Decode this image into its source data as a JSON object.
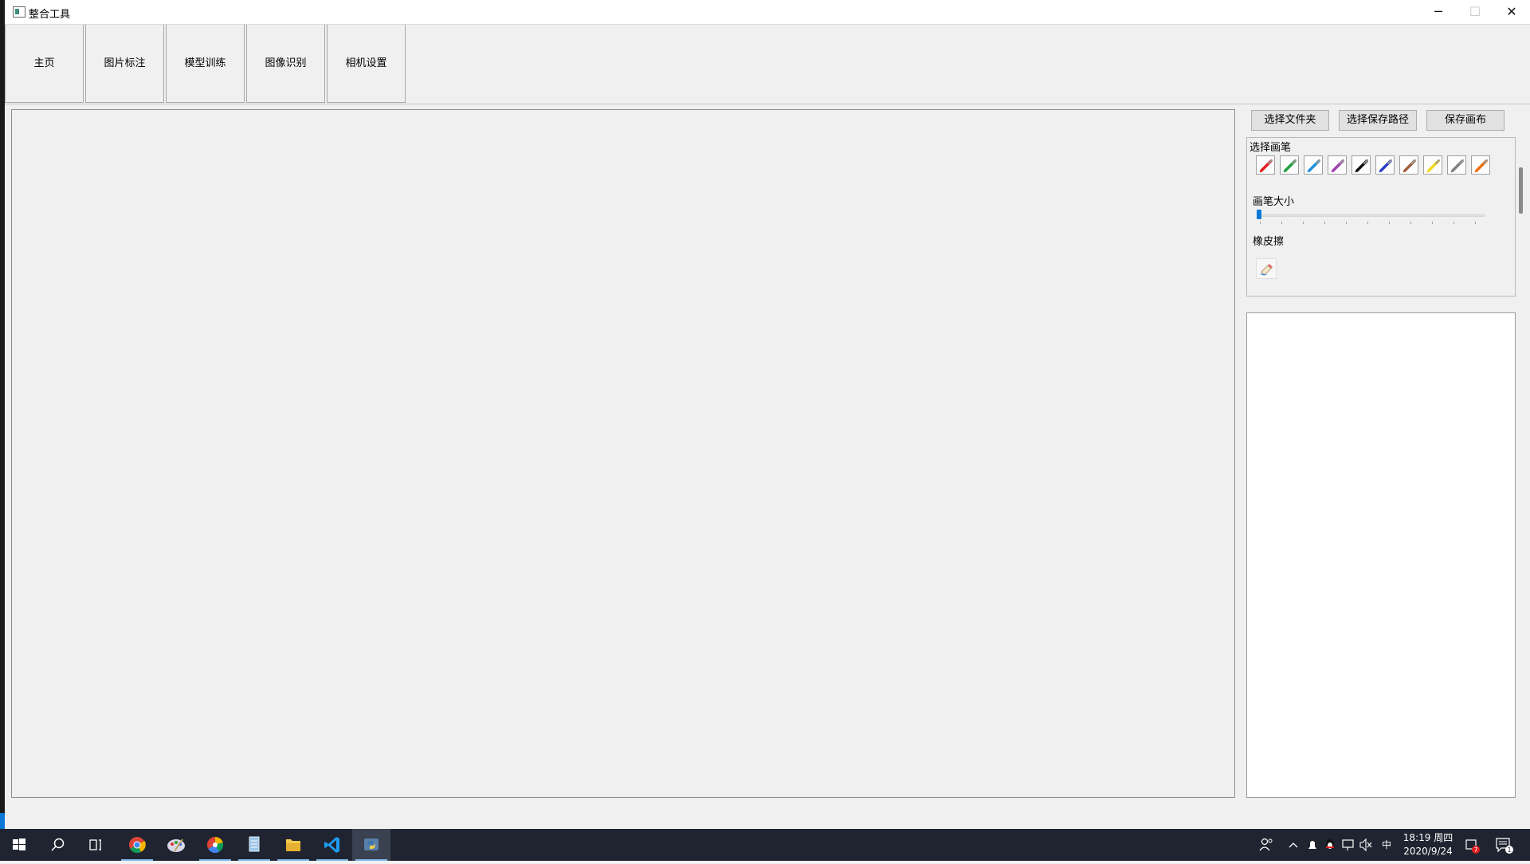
{
  "window": {
    "title": "整合工具",
    "minimize_glyph": "─",
    "maximize_glyph": "☐",
    "close_glyph": "✕"
  },
  "tabs": [
    {
      "label": "主页"
    },
    {
      "label": "图片标注"
    },
    {
      "label": "模型训练"
    },
    {
      "label": "图像识别"
    },
    {
      "label": "相机设置"
    }
  ],
  "toolbar": {
    "select_folder": "选择文件夹",
    "select_save_path": "选择保存路径",
    "save_canvas": "保存画布"
  },
  "pen_panel": {
    "title": "选择画笔",
    "pens": [
      {
        "name": "red-pen-icon",
        "color": "#e0201f"
      },
      {
        "name": "green-pen-icon",
        "color": "#1fa040"
      },
      {
        "name": "cyan-pen-icon",
        "color": "#1e90e0"
      },
      {
        "name": "purple-pen-icon",
        "color": "#a040b0"
      },
      {
        "name": "black-pen-icon",
        "color": "#111111"
      },
      {
        "name": "blue-pen-icon",
        "color": "#2a3fc8"
      },
      {
        "name": "brown-pen-icon",
        "color": "#a0603a"
      },
      {
        "name": "yellow-pen-icon",
        "color": "#f0d820"
      },
      {
        "name": "gray-pen-icon",
        "color": "#808080"
      },
      {
        "name": "orange-pen-icon",
        "color": "#f07010"
      }
    ],
    "size_label": "画笔大小",
    "size_value_fraction": 0.0,
    "eraser_label": "橡皮擦"
  },
  "taskbar": {
    "time": "18:19 周四",
    "date": "2020/9/24",
    "ime": "中",
    "notification_count": "1",
    "badge_count": "7"
  },
  "colors": {
    "accent": "#0a78d7",
    "taskbar_bg": "#1f2430"
  }
}
